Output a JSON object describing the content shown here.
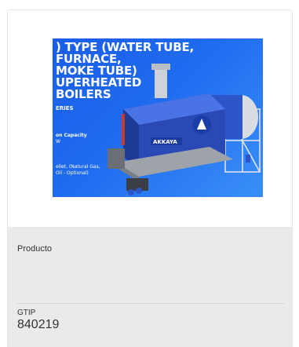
{
  "product": {
    "image_alt": "Boiler product image",
    "image_text": {
      "line1": ") TYPE (WATER TUBE,",
      "line2": "FURNACE,",
      "line3": "MOKE TUBE)",
      "line4": "UPERHEATED",
      "line5": "BOILERS",
      "series": "ERIES",
      "capacity_label": "on Capacity",
      "capacity_unit": "W",
      "fuel_line1": "ellet, (Natural Gas,",
      "fuel_line2": "Oil - Optional)",
      "brand": "AKKAYA"
    },
    "type_label": "Producto",
    "gtip_label": "GTIP",
    "gtip_value": "840219"
  },
  "colors": {
    "image_bg": "#1f6cf0",
    "info_bg": "#eaeaea",
    "boiler_body": "#2b55c9"
  }
}
